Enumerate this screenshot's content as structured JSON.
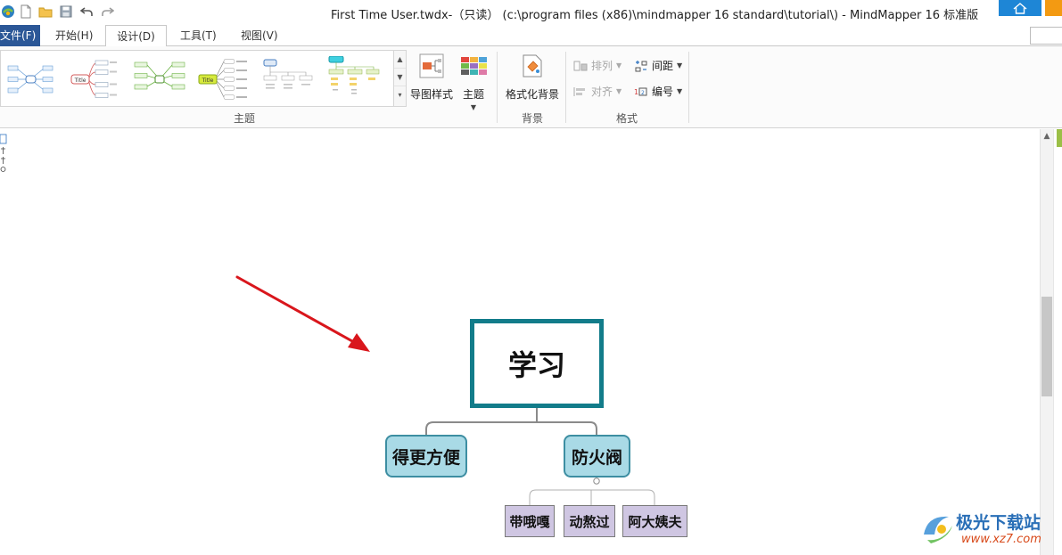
{
  "window": {
    "title": "First Time User.twdx-（只读） (c:\\program files (x86)\\mindmapper 16 standard\\tutorial\\) - MindMapper 16 标准版"
  },
  "quick_access": [
    "app-logo-icon",
    "new-doc-icon",
    "open-folder-icon",
    "save-icon",
    "undo-icon",
    "redo-icon"
  ],
  "menu": {
    "tabs": [
      "文件(F)",
      "开始(H)",
      "设计(D)",
      "工具(T)",
      "视图(V)"
    ],
    "active": "设计(D)"
  },
  "ribbon": {
    "theme_group_label": "主题",
    "map_style_label": "导图样式",
    "theme_label": "主题",
    "format_bg_label": "格式化背景",
    "bg_group_label": "背景",
    "arrange_label": "排列",
    "align_label": "对齐",
    "spacing_label": "间距",
    "numbering_label": "编号",
    "format_group_label": "格式"
  },
  "mindmap": {
    "central": "学习",
    "branches": [
      {
        "label": "得更方便"
      },
      {
        "label": "防火阀"
      }
    ],
    "sub_topics": [
      "带哦嘎",
      "动熬过",
      "阿大姨夫"
    ]
  },
  "colors": {
    "central_border": "#127c8a",
    "main_fill": "#a9dae6",
    "main_border": "#3d8ea2",
    "sub_fill": "#cfc6e2",
    "arrow": "#d9161c",
    "file_tab": "#2b5797"
  },
  "watermark": {
    "brand": "极光下载站",
    "url": "www.xz7.com"
  }
}
